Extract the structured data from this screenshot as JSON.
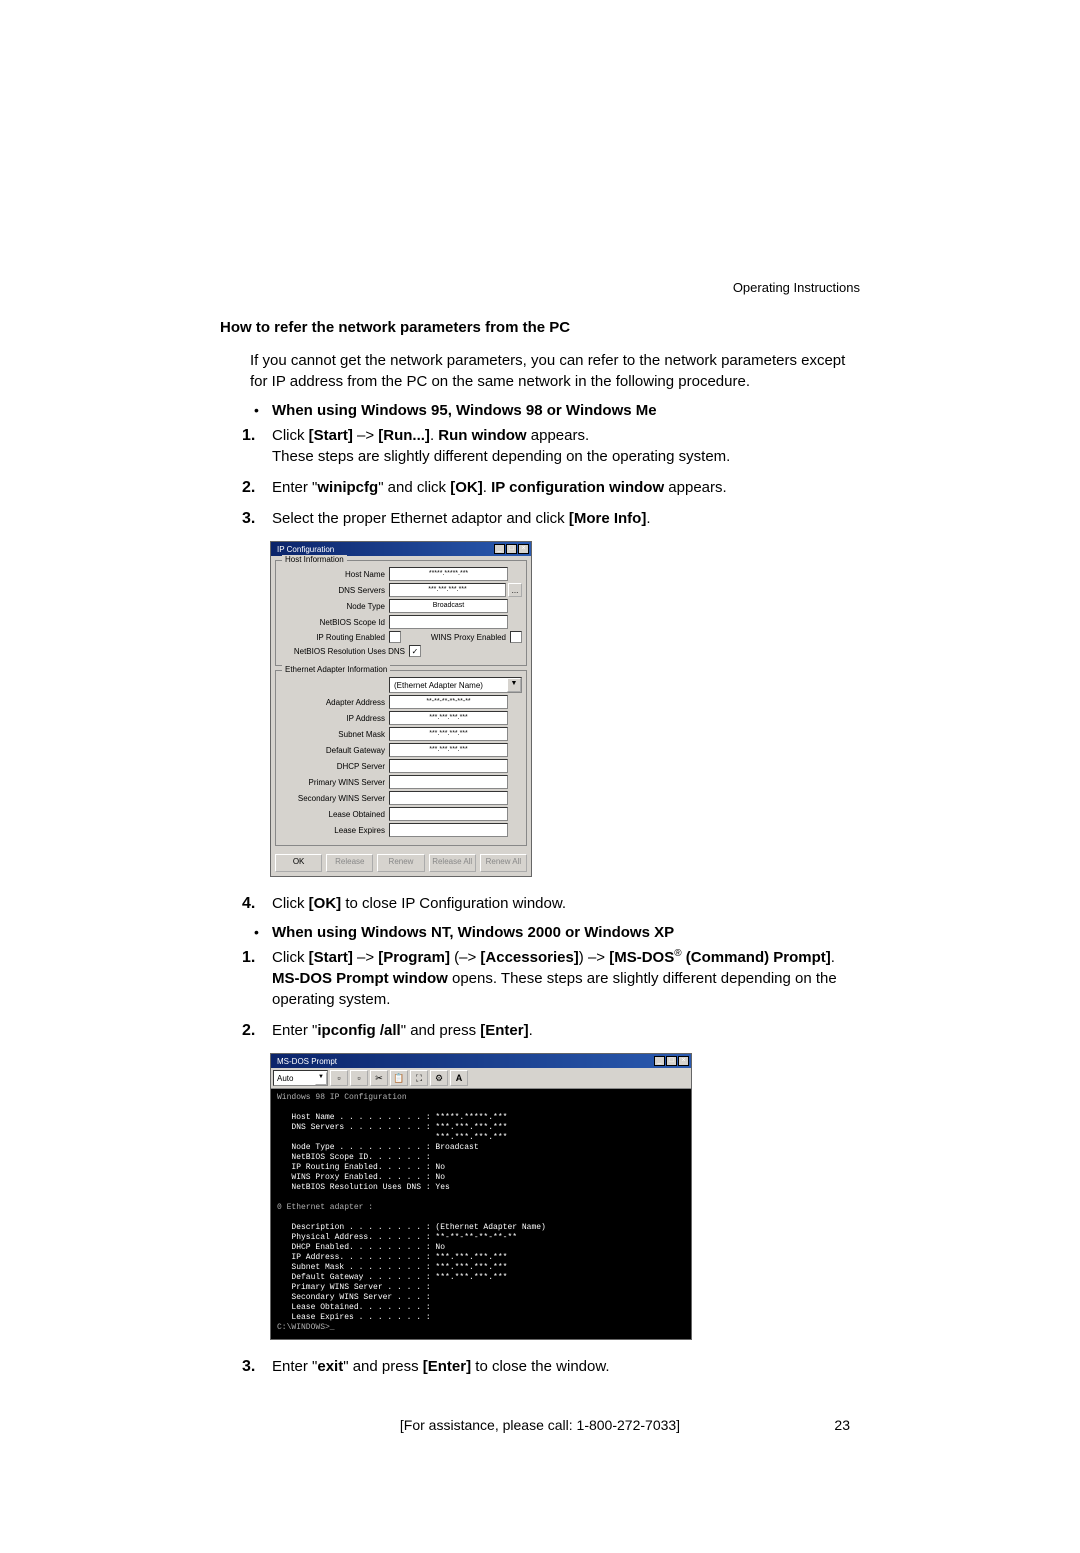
{
  "header": {
    "right": "Operating Instructions"
  },
  "section": {
    "title": "How to refer the network parameters from the PC",
    "intro": "If you cannot get the network parameters, you can refer to the network parameters except for IP address from the PC on the same network in the following procedure.",
    "sub1_title": "When using Windows 95, Windows 98 or Windows Me",
    "steps1": {
      "s1_a": "Click ",
      "s1_start": "[Start]",
      "s1_arrow": " –> ",
      "s1_run": "[Run...]",
      "s1_dot": ". ",
      "s1_runwin": "Run window",
      "s1_b": " appears.",
      "s1_c": "These steps are slightly different depending on the operating system.",
      "s2_a": "Enter \"",
      "s2_cmd": "winipcfg",
      "s2_b": "\" and click ",
      "s2_ok": "[OK]",
      "s2_c": ". ",
      "s2_win": "IP configuration window",
      "s2_d": " appears.",
      "s3_a": "Select the proper Ethernet adaptor and click ",
      "s3_more": "[More Info]",
      "s3_b": ".",
      "s4_a": "Click ",
      "s4_ok": "[OK]",
      "s4_b": " to close IP Configuration window."
    },
    "sub2_title": "When using Windows NT, Windows 2000 or Windows XP",
    "steps2": {
      "s1_a": "Click ",
      "s1_start": "[Start]",
      "s1_ar1": " –> ",
      "s1_prog": "[Program]",
      "s1_paren": " (–> ",
      "s1_acc": "[Accessories]",
      "s1_pclose": ") –> ",
      "s1_msdos": "[MS-DOS",
      "s1_reg": "®",
      "s1_cmd": " (Command) Prompt]",
      "s1_dot": ". ",
      "s1_win": "MS-DOS Prompt window",
      "s1_b": " opens. These steps are slightly different depending on the operating system.",
      "s2_a": "Enter \"",
      "s2_cmd": "ipconfig /all",
      "s2_b": "\" and press ",
      "s2_enter": "[Enter]",
      "s2_c": ".",
      "s3_a": "Enter \"",
      "s3_cmd": "exit",
      "s3_b": "\" and press ",
      "s3_enter": "[Enter]",
      "s3_c": " to close the window."
    }
  },
  "ipconfig": {
    "title": "IP Configuration",
    "group1": "Host Information",
    "group2": "Ethernet Adapter Information",
    "rows1": {
      "host_name": {
        "label": "Host Name",
        "value": "*****.*****.***"
      },
      "dns_servers": {
        "label": "DNS Servers",
        "value": "***.***.***.***"
      },
      "node_type": {
        "label": "Node Type",
        "value": "Broadcast"
      },
      "netbios_scope": {
        "label": "NetBIOS Scope Id",
        "value": ""
      },
      "ip_routing": {
        "label": "IP Routing Enabled",
        "value": ""
      },
      "wins_proxy": {
        "label": "WINS Proxy Enabled",
        "value": ""
      },
      "netbios_dns": {
        "label": "NetBIOS Resolution Uses DNS",
        "value": ""
      }
    },
    "adapter_select": "(Ethernet Adapter Name)",
    "rows2": {
      "adapter_addr": {
        "label": "Adapter Address",
        "value": "**-**-**-**-**-**"
      },
      "ip_addr": {
        "label": "IP Address",
        "value": "***.***.***.***"
      },
      "subnet": {
        "label": "Subnet Mask",
        "value": "***.***.***.***"
      },
      "gateway": {
        "label": "Default Gateway",
        "value": "***.***.***.***"
      },
      "dhcp": {
        "label": "DHCP Server",
        "value": ""
      },
      "pwins": {
        "label": "Primary WINS Server",
        "value": ""
      },
      "swins": {
        "label": "Secondary WINS Server",
        "value": ""
      },
      "lease_obt": {
        "label": "Lease Obtained",
        "value": ""
      },
      "lease_exp": {
        "label": "Lease Expires",
        "value": ""
      }
    },
    "buttons": {
      "ok": "OK",
      "release": "Release",
      "renew": "Renew",
      "release_all": "Release All",
      "renew_all": "Renew All"
    },
    "more_btn": "..."
  },
  "dos": {
    "title": "MS-DOS Prompt",
    "combo": "Auto",
    "body_line1": "Windows 98 IP Configuration",
    "host_name": "   Host Name . . . . . . . . . : *****.*****.***",
    "dns": "   DNS Servers . . . . . . . . : ***.***.***.***",
    "dns2": "                                 ***.***.***.***",
    "node": "   Node Type . . . . . . . . . : Broadcast",
    "nbscope": "   NetBIOS Scope ID. . . . . . :",
    "iprt": "   IP Routing Enabled. . . . . : No",
    "wproxy": "   WINS Proxy Enabled. . . . . : No",
    "nbdns": "   NetBIOS Resolution Uses DNS : Yes",
    "eth_hdr": "0 Ethernet adapter :",
    "desc": "   Description . . . . . . . . : (Ethernet Adapter Name)",
    "phys": "   Physical Address. . . . . . : **-**-**-**-**-**",
    "dhcp": "   DHCP Enabled. . . . . . . . : No",
    "ip": "   IP Address. . . . . . . . . : ***.***.***.***",
    "mask": "   Subnet Mask . . . . . . . . : ***.***.***.***",
    "gw": "   Default Gateway . . . . . . : ***.***.***.***",
    "pwins": "   Primary WINS Server . . . . :",
    "swins": "   Secondary WINS Server . . . :",
    "lobt": "   Lease Obtained. . . . . . . :",
    "lexp": "   Lease Expires . . . . . . . :",
    "prompt": "C:\\WINDOWS>_"
  },
  "footer": {
    "assist": "[For assistance, please call: 1-800-272-7033]",
    "page": "23"
  }
}
